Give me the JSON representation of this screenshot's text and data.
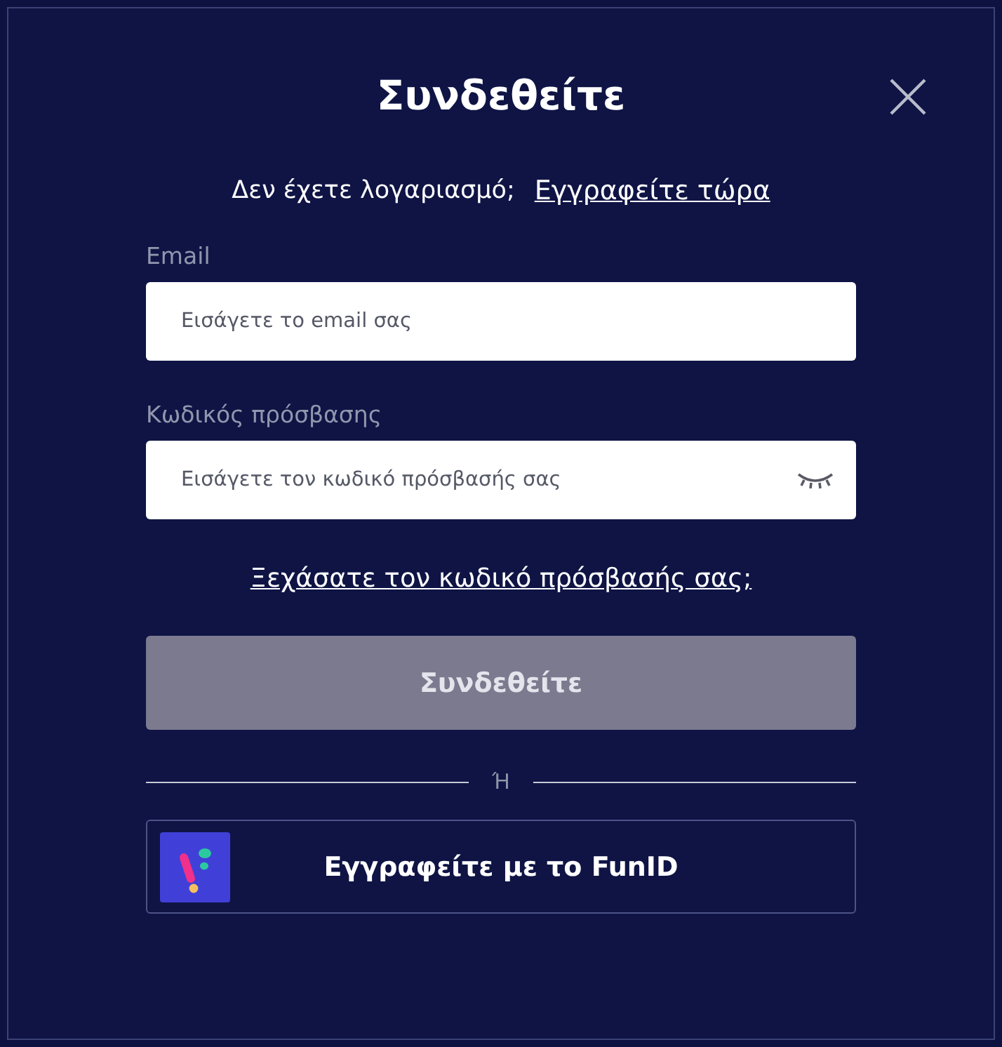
{
  "dialog": {
    "title": "Συνδεθείτε"
  },
  "signup_prompt": {
    "text": "Δεν έχετε λογαριασμό;",
    "link": "Εγγραφείτε τώρα"
  },
  "fields": [
    {
      "label": "Email",
      "placeholder": "Εισάγετε το email σας",
      "kind": "email"
    },
    {
      "label": "Κωδικός πρόσβασης",
      "placeholder": "Εισάγετε τον κωδικό πρόσβασής σας",
      "kind": "password"
    }
  ],
  "forgot_link": "Ξεχάσατε τον κωδικό πρόσβασής σας;",
  "submit_button": {
    "label": "Συνδεθείτε",
    "disabled": true
  },
  "divider_text": "Ή",
  "funid_button": {
    "label": "Εγγραφείτε με το FunID"
  }
}
